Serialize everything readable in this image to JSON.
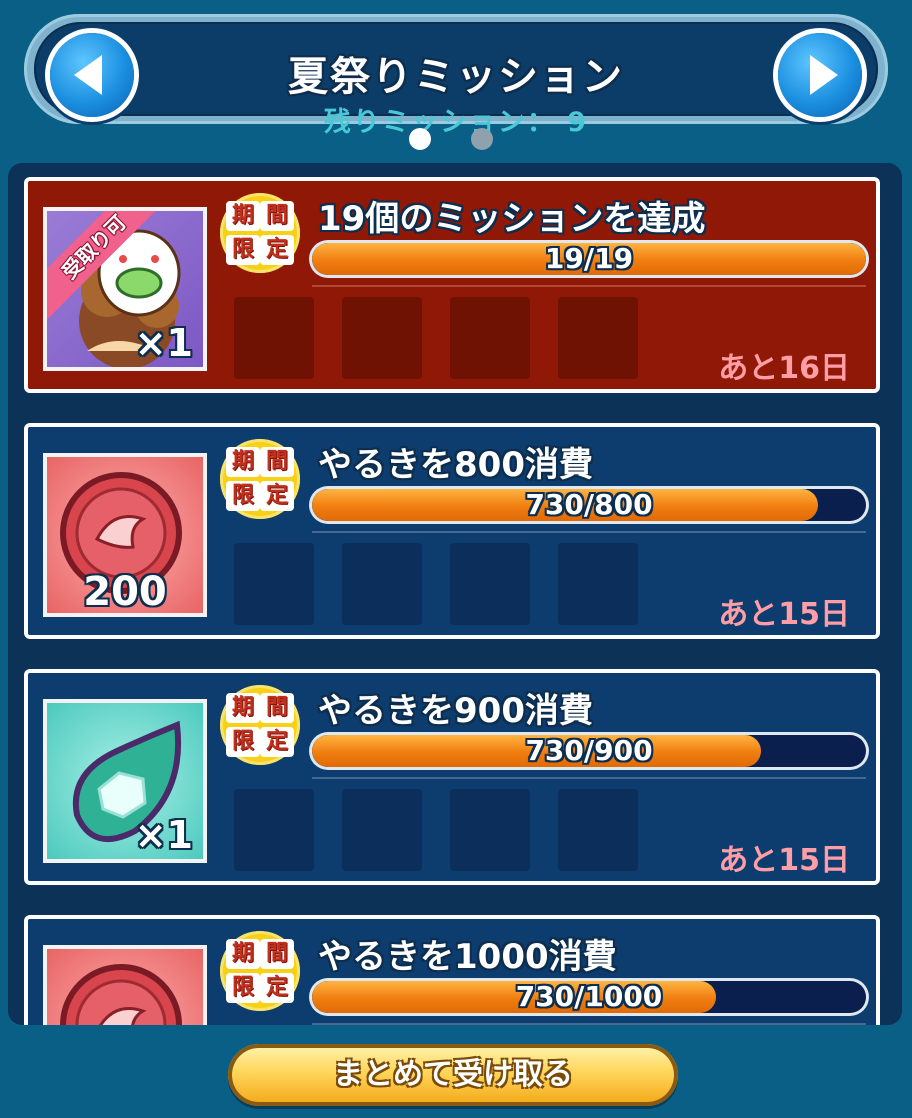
{
  "header": {
    "title": "夏祭りミッション",
    "remaining_label": "残りミッション：",
    "remaining_count": "9"
  },
  "pagination": {
    "current": 1,
    "total": 2
  },
  "missions": [
    {
      "name": "19個のミッションを達成",
      "progress": "19/19",
      "progress_fraction": 1.0,
      "remaining": "あと16日",
      "reward_qty": "×1",
      "reward_icon": "character-mask-icon",
      "claimable": true,
      "ribbon": "受取り可"
    },
    {
      "name": "やるきを800消費",
      "progress": "730/800",
      "progress_fraction": 0.9125,
      "remaining": "あと15日",
      "reward_qty": "200",
      "reward_icon": "red-coin-icon",
      "claimable": false
    },
    {
      "name": "やるきを900消費",
      "progress": "730/900",
      "progress_fraction": 0.811,
      "remaining": "あと15日",
      "reward_qty": "×1",
      "reward_icon": "green-gem-icon",
      "claimable": false
    },
    {
      "name": "やるきを1000消費",
      "progress": "730/1000",
      "progress_fraction": 0.73,
      "remaining": "",
      "reward_qty": "",
      "reward_icon": "red-coin-icon",
      "claimable": false
    }
  ],
  "limited_badge": {
    "c1": "期",
    "c2": "間",
    "c3": "限",
    "c4": "定"
  },
  "claim_all_button": "まとめて受け取る",
  "colors": {
    "claimable_bg": "#901806",
    "normal_bg": "#0d3c6e",
    "progress": "#f07e10",
    "remaining_text": "#ff9ea6"
  }
}
